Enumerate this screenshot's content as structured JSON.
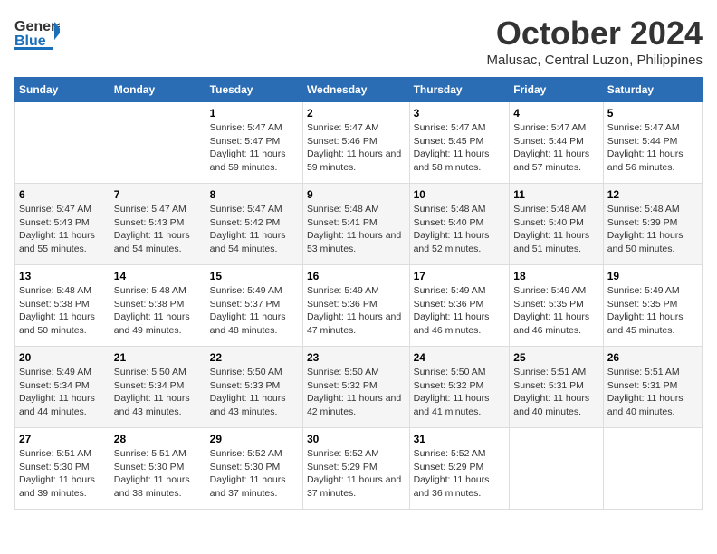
{
  "logo": {
    "line1": "General",
    "line2": "Blue"
  },
  "title": "October 2024",
  "subtitle": "Malusac, Central Luzon, Philippines",
  "weekdays": [
    "Sunday",
    "Monday",
    "Tuesday",
    "Wednesday",
    "Thursday",
    "Friday",
    "Saturday"
  ],
  "weeks": [
    [
      {
        "day": "",
        "sunrise": "",
        "sunset": "",
        "daylight": ""
      },
      {
        "day": "",
        "sunrise": "",
        "sunset": "",
        "daylight": ""
      },
      {
        "day": "1",
        "sunrise": "Sunrise: 5:47 AM",
        "sunset": "Sunset: 5:47 PM",
        "daylight": "Daylight: 11 hours and 59 minutes."
      },
      {
        "day": "2",
        "sunrise": "Sunrise: 5:47 AM",
        "sunset": "Sunset: 5:46 PM",
        "daylight": "Daylight: 11 hours and 59 minutes."
      },
      {
        "day": "3",
        "sunrise": "Sunrise: 5:47 AM",
        "sunset": "Sunset: 5:45 PM",
        "daylight": "Daylight: 11 hours and 58 minutes."
      },
      {
        "day": "4",
        "sunrise": "Sunrise: 5:47 AM",
        "sunset": "Sunset: 5:44 PM",
        "daylight": "Daylight: 11 hours and 57 minutes."
      },
      {
        "day": "5",
        "sunrise": "Sunrise: 5:47 AM",
        "sunset": "Sunset: 5:44 PM",
        "daylight": "Daylight: 11 hours and 56 minutes."
      }
    ],
    [
      {
        "day": "6",
        "sunrise": "Sunrise: 5:47 AM",
        "sunset": "Sunset: 5:43 PM",
        "daylight": "Daylight: 11 hours and 55 minutes."
      },
      {
        "day": "7",
        "sunrise": "Sunrise: 5:47 AM",
        "sunset": "Sunset: 5:43 PM",
        "daylight": "Daylight: 11 hours and 54 minutes."
      },
      {
        "day": "8",
        "sunrise": "Sunrise: 5:47 AM",
        "sunset": "Sunset: 5:42 PM",
        "daylight": "Daylight: 11 hours and 54 minutes."
      },
      {
        "day": "9",
        "sunrise": "Sunrise: 5:48 AM",
        "sunset": "Sunset: 5:41 PM",
        "daylight": "Daylight: 11 hours and 53 minutes."
      },
      {
        "day": "10",
        "sunrise": "Sunrise: 5:48 AM",
        "sunset": "Sunset: 5:40 PM",
        "daylight": "Daylight: 11 hours and 52 minutes."
      },
      {
        "day": "11",
        "sunrise": "Sunrise: 5:48 AM",
        "sunset": "Sunset: 5:40 PM",
        "daylight": "Daylight: 11 hours and 51 minutes."
      },
      {
        "day": "12",
        "sunrise": "Sunrise: 5:48 AM",
        "sunset": "Sunset: 5:39 PM",
        "daylight": "Daylight: 11 hours and 50 minutes."
      }
    ],
    [
      {
        "day": "13",
        "sunrise": "Sunrise: 5:48 AM",
        "sunset": "Sunset: 5:38 PM",
        "daylight": "Daylight: 11 hours and 50 minutes."
      },
      {
        "day": "14",
        "sunrise": "Sunrise: 5:48 AM",
        "sunset": "Sunset: 5:38 PM",
        "daylight": "Daylight: 11 hours and 49 minutes."
      },
      {
        "day": "15",
        "sunrise": "Sunrise: 5:49 AM",
        "sunset": "Sunset: 5:37 PM",
        "daylight": "Daylight: 11 hours and 48 minutes."
      },
      {
        "day": "16",
        "sunrise": "Sunrise: 5:49 AM",
        "sunset": "Sunset: 5:36 PM",
        "daylight": "Daylight: 11 hours and 47 minutes."
      },
      {
        "day": "17",
        "sunrise": "Sunrise: 5:49 AM",
        "sunset": "Sunset: 5:36 PM",
        "daylight": "Daylight: 11 hours and 46 minutes."
      },
      {
        "day": "18",
        "sunrise": "Sunrise: 5:49 AM",
        "sunset": "Sunset: 5:35 PM",
        "daylight": "Daylight: 11 hours and 46 minutes."
      },
      {
        "day": "19",
        "sunrise": "Sunrise: 5:49 AM",
        "sunset": "Sunset: 5:35 PM",
        "daylight": "Daylight: 11 hours and 45 minutes."
      }
    ],
    [
      {
        "day": "20",
        "sunrise": "Sunrise: 5:49 AM",
        "sunset": "Sunset: 5:34 PM",
        "daylight": "Daylight: 11 hours and 44 minutes."
      },
      {
        "day": "21",
        "sunrise": "Sunrise: 5:50 AM",
        "sunset": "Sunset: 5:34 PM",
        "daylight": "Daylight: 11 hours and 43 minutes."
      },
      {
        "day": "22",
        "sunrise": "Sunrise: 5:50 AM",
        "sunset": "Sunset: 5:33 PM",
        "daylight": "Daylight: 11 hours and 43 minutes."
      },
      {
        "day": "23",
        "sunrise": "Sunrise: 5:50 AM",
        "sunset": "Sunset: 5:32 PM",
        "daylight": "Daylight: 11 hours and 42 minutes."
      },
      {
        "day": "24",
        "sunrise": "Sunrise: 5:50 AM",
        "sunset": "Sunset: 5:32 PM",
        "daylight": "Daylight: 11 hours and 41 minutes."
      },
      {
        "day": "25",
        "sunrise": "Sunrise: 5:51 AM",
        "sunset": "Sunset: 5:31 PM",
        "daylight": "Daylight: 11 hours and 40 minutes."
      },
      {
        "day": "26",
        "sunrise": "Sunrise: 5:51 AM",
        "sunset": "Sunset: 5:31 PM",
        "daylight": "Daylight: 11 hours and 40 minutes."
      }
    ],
    [
      {
        "day": "27",
        "sunrise": "Sunrise: 5:51 AM",
        "sunset": "Sunset: 5:30 PM",
        "daylight": "Daylight: 11 hours and 39 minutes."
      },
      {
        "day": "28",
        "sunrise": "Sunrise: 5:51 AM",
        "sunset": "Sunset: 5:30 PM",
        "daylight": "Daylight: 11 hours and 38 minutes."
      },
      {
        "day": "29",
        "sunrise": "Sunrise: 5:52 AM",
        "sunset": "Sunset: 5:30 PM",
        "daylight": "Daylight: 11 hours and 37 minutes."
      },
      {
        "day": "30",
        "sunrise": "Sunrise: 5:52 AM",
        "sunset": "Sunset: 5:29 PM",
        "daylight": "Daylight: 11 hours and 37 minutes."
      },
      {
        "day": "31",
        "sunrise": "Sunrise: 5:52 AM",
        "sunset": "Sunset: 5:29 PM",
        "daylight": "Daylight: 11 hours and 36 minutes."
      },
      {
        "day": "",
        "sunrise": "",
        "sunset": "",
        "daylight": ""
      },
      {
        "day": "",
        "sunrise": "",
        "sunset": "",
        "daylight": ""
      }
    ]
  ]
}
